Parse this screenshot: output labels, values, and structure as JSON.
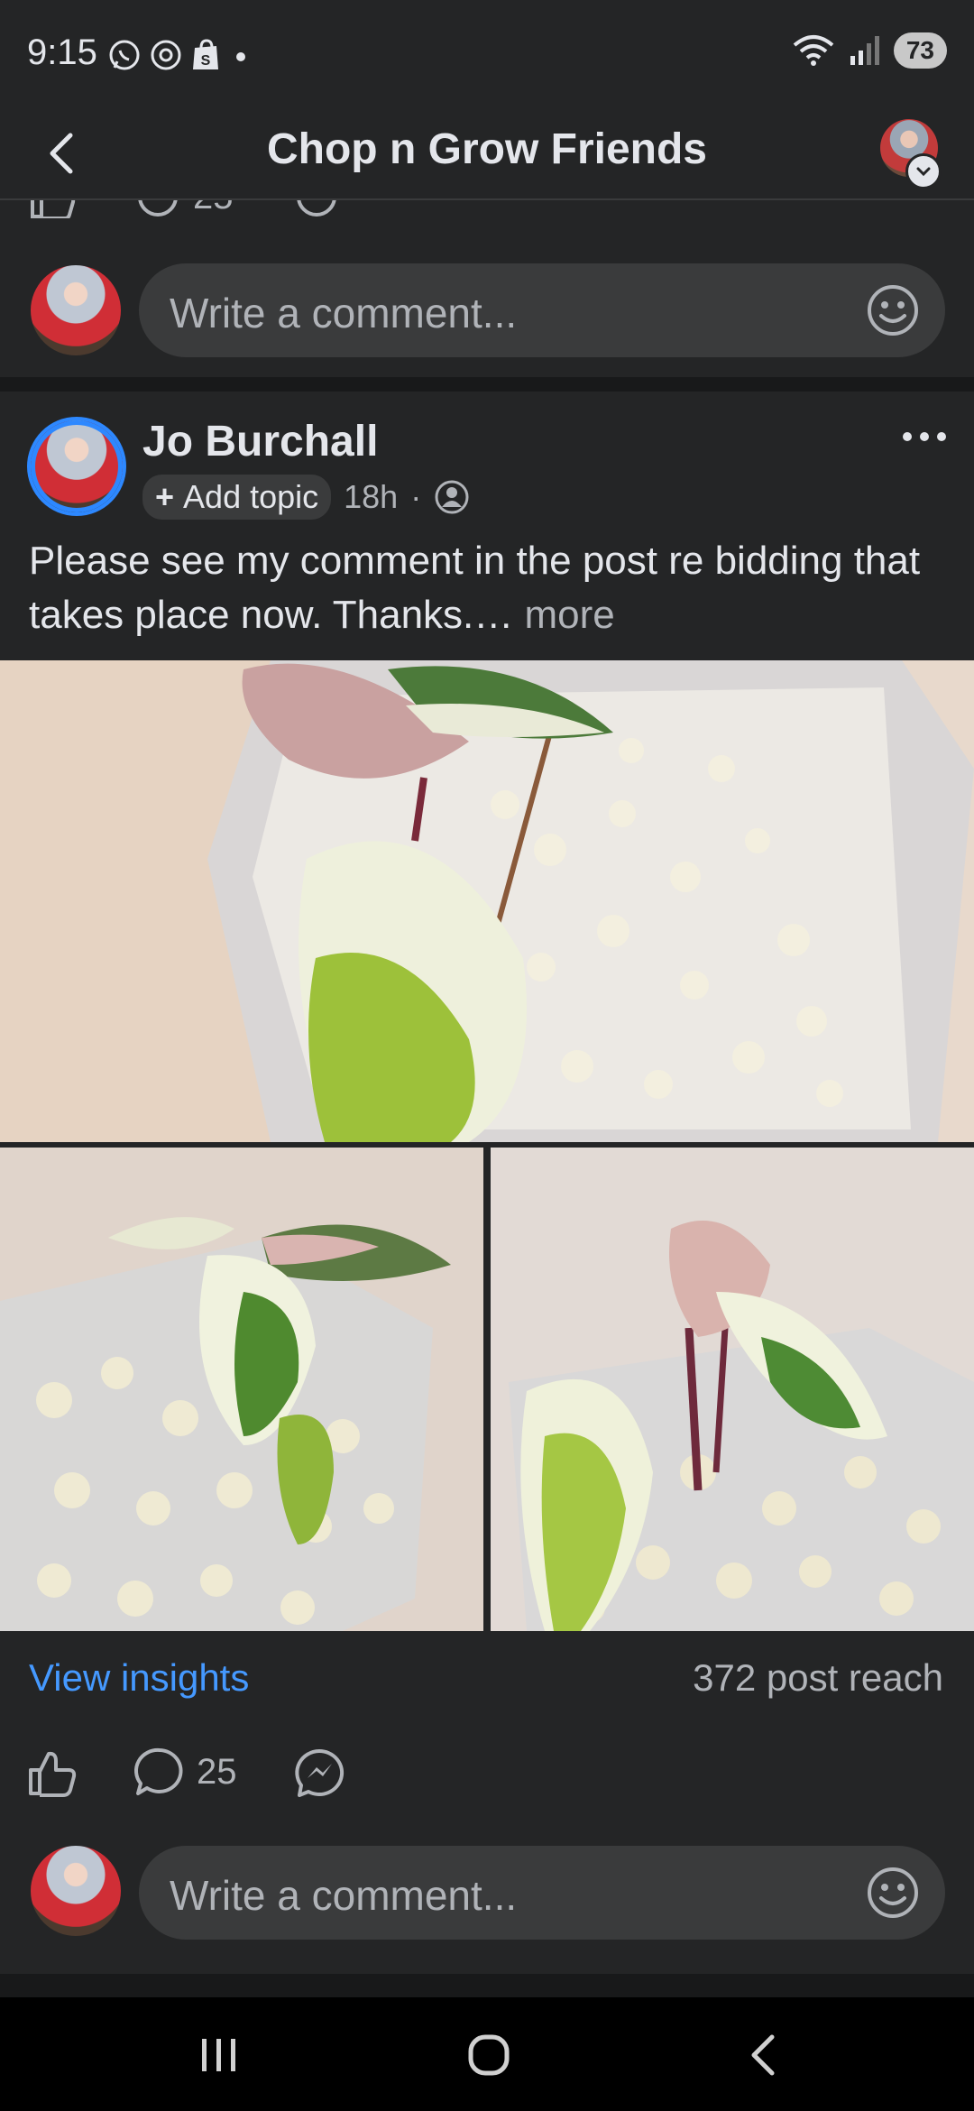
{
  "status_bar": {
    "time": "9:15",
    "battery": "73",
    "left_icons": [
      "whatsapp-icon",
      "threads-icon",
      "shopify-icon",
      "dot-icon"
    ],
    "right_icons": [
      "wifi-icon",
      "signal-icon",
      "battery-icon"
    ]
  },
  "header": {
    "title": "Chop n Grow Friends"
  },
  "top_comment": {
    "placeholder": "Write a comment...",
    "partial_count": "25"
  },
  "post": {
    "author": "Jo Burchall",
    "add_topic": "Add topic",
    "time": "18h",
    "separator": "·",
    "text": "Please see my comment in the post re bidding that takes place now. Thanks.…",
    "more": "more",
    "view_insights": "View insights",
    "reach": "372 post reach",
    "comment_count": "25",
    "comment_placeholder": "Write a comment..."
  },
  "colors": {
    "background": "#18191a",
    "card": "#242526",
    "link": "#4599ff",
    "text": "#e4e6eb",
    "muted": "#b0b3b8"
  }
}
